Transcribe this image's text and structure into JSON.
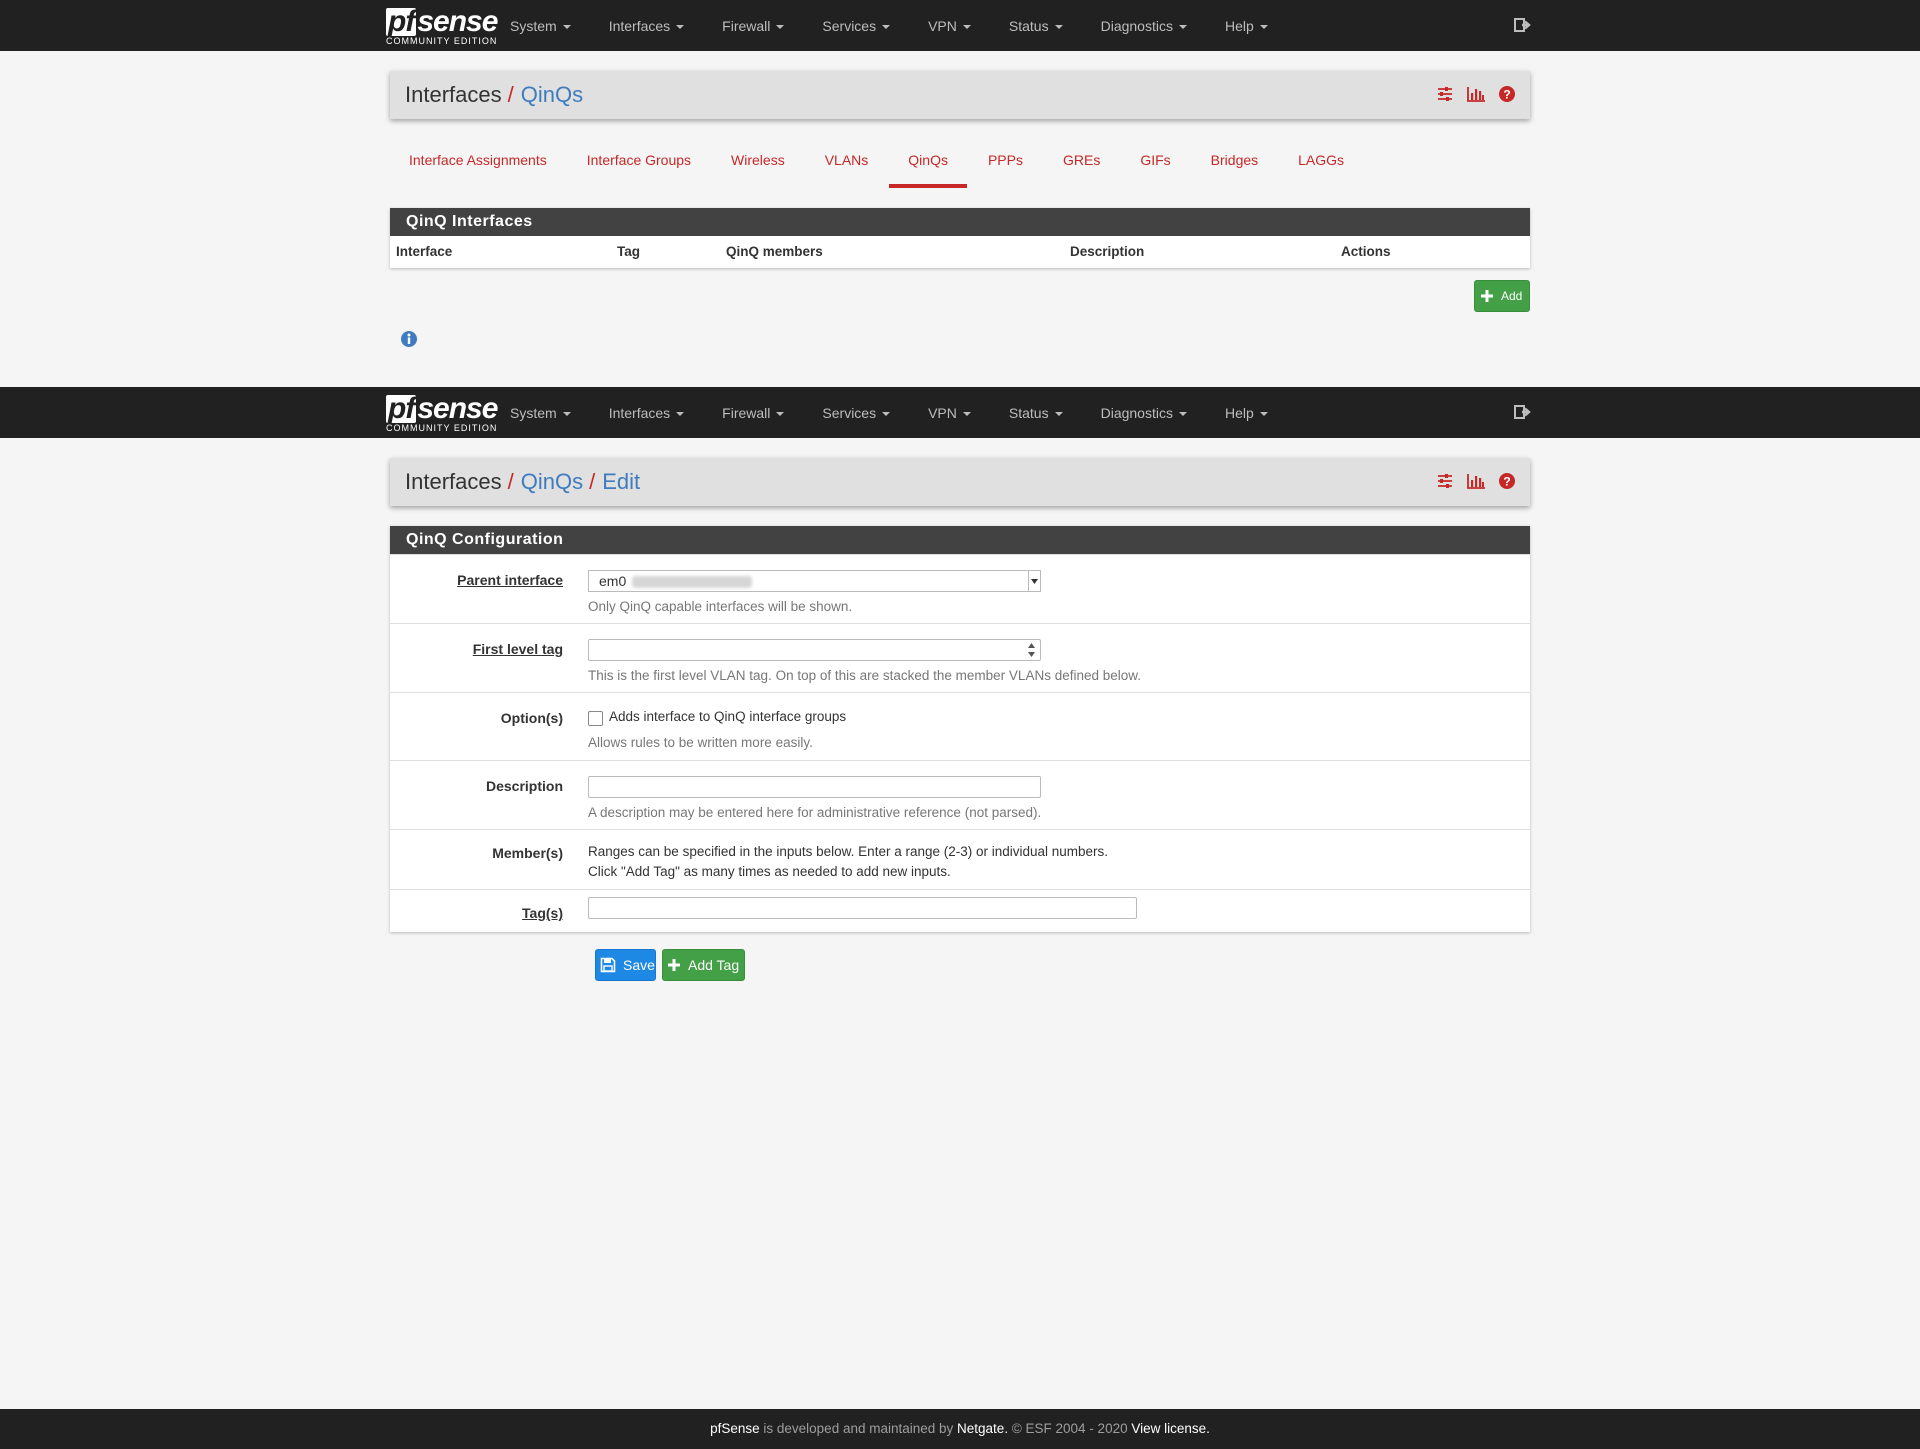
{
  "nav": {
    "brand": "sense",
    "brand_pf": "pf",
    "brand_sub": "COMMUNITY EDITION",
    "items": [
      "System",
      "Interfaces",
      "Firewall",
      "Services",
      "VPN",
      "Status",
      "Diagnostics",
      "Help"
    ]
  },
  "page1": {
    "breadcrumb": {
      "root": "Interfaces",
      "current": "QinQs"
    },
    "tabs": [
      "Interface Assignments",
      "Interface Groups",
      "Wireless",
      "VLANs",
      "QinQs",
      "PPPs",
      "GREs",
      "GIFs",
      "Bridges",
      "LAGGs"
    ],
    "active_tab": "QinQs",
    "panel_title": "QinQ Interfaces",
    "columns": [
      "Interface",
      "Tag",
      "QinQ members",
      "Description",
      "Actions"
    ],
    "add_label": "Add"
  },
  "page2": {
    "breadcrumb": {
      "root": "Interfaces",
      "middle": "QinQs",
      "current": "Edit"
    },
    "panel_title": "QinQ Configuration",
    "fields": {
      "parent": {
        "label": "Parent interface",
        "value": "em0",
        "help": "Only QinQ capable interfaces will be shown."
      },
      "first_tag": {
        "label": "First level tag",
        "value": "",
        "help": "This is the first level VLAN tag. On top of this are stacked the member VLANs defined below."
      },
      "options": {
        "label": "Option(s)",
        "checkbox_label": "Adds interface to QinQ interface groups",
        "help": "Allows rules to be written more easily.",
        "checked": false
      },
      "description": {
        "label": "Description",
        "value": "",
        "help": "A description may be entered here for administrative reference (not parsed)."
      },
      "members": {
        "label": "Member(s)",
        "line1": "Ranges can be specified in the inputs below. Enter a range (2-3) or individual numbers.",
        "line2": "Click \"Add Tag\" as many times as needed to add new inputs."
      },
      "tags": {
        "label": "Tag(s)",
        "value": ""
      }
    },
    "save_label": "Save",
    "add_tag_label": "Add Tag"
  },
  "footer": {
    "product": "pfSense",
    "text1": " is developed and maintained by ",
    "company": "Netgate.",
    "text2": " © ESF 2004 - 2020 ",
    "license": "View license."
  },
  "colors": {
    "accent_red": "#c62828",
    "link_blue": "#3f7cbf",
    "navbar": "#212121",
    "success_green": "#43a047",
    "primary_blue": "#1e88e5"
  }
}
